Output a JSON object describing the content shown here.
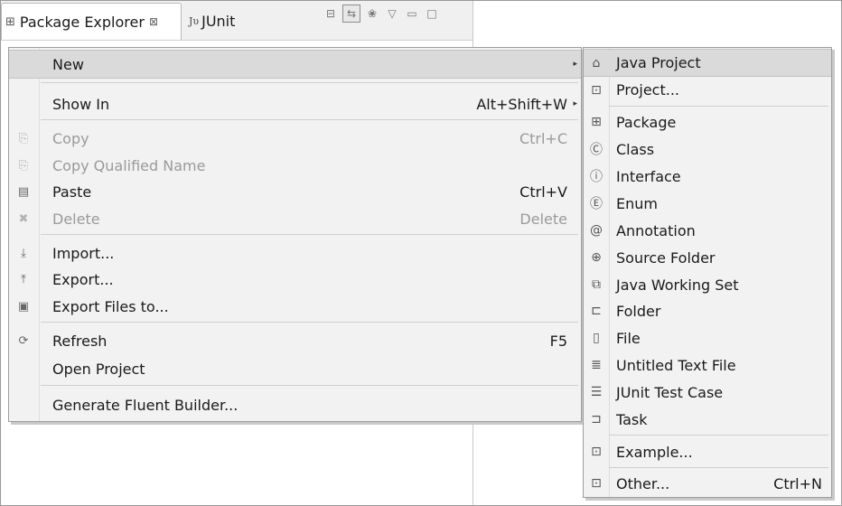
{
  "tabs": {
    "package_explorer": {
      "label": "Package Explorer",
      "icon": "package-explorer-icon",
      "close": "⊠"
    },
    "junit": {
      "label": "JUnit",
      "glyph": "Jυ"
    }
  },
  "context_menu": {
    "new": "New",
    "show_in": {
      "label": "Show In",
      "accel": "Alt+Shift+W"
    },
    "copy": {
      "label": "Copy",
      "accel": "Ctrl+C"
    },
    "copy_qualified_name": "Copy Qualified Name",
    "paste": {
      "label": "Paste",
      "accel": "Ctrl+V"
    },
    "delete": {
      "label": "Delete",
      "accel": "Delete"
    },
    "import": "Import...",
    "export": "Export...",
    "export_files_to": "Export Files to...",
    "refresh": {
      "label": "Refresh",
      "accel": "F5"
    },
    "open_project": "Open Project",
    "generate_fluent_builder": "Generate Fluent Builder..."
  },
  "new_submenu": {
    "java_project": "Java Project",
    "project": "Project...",
    "package": "Package",
    "class": "Class",
    "interface": "Interface",
    "enum": "Enum",
    "annotation": "Annotation",
    "source_folder": "Source Folder",
    "java_working_set": "Java Working Set",
    "folder": "Folder",
    "file": "File",
    "untitled_text_file": "Untitled Text File",
    "junit_test_case": "JUnit Test Case",
    "task": "Task",
    "example": "Example...",
    "other": {
      "label": "Other...",
      "accel": "Ctrl+N"
    }
  }
}
